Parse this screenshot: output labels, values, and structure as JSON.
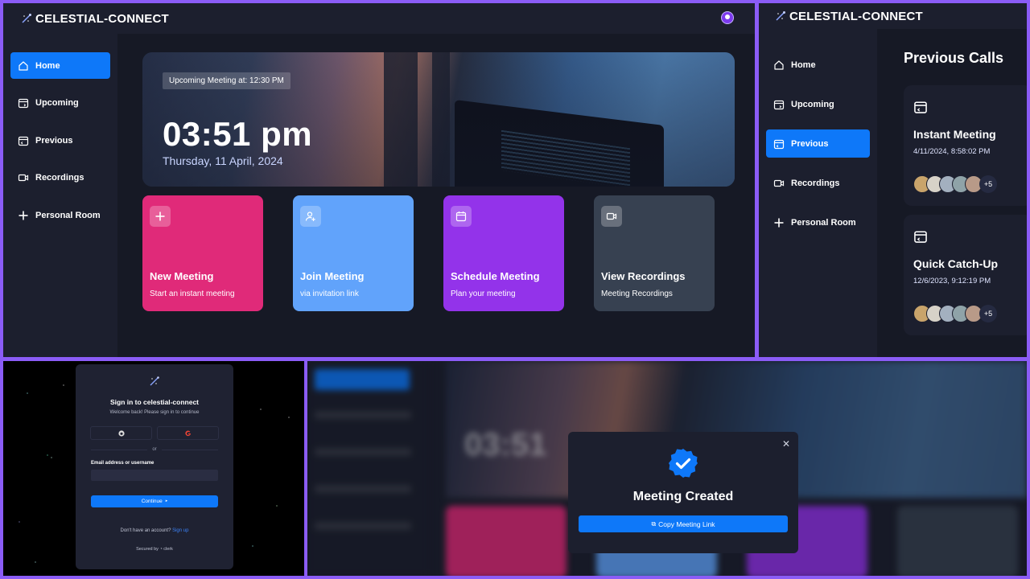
{
  "brand": "CELESTIAL-CONNECT",
  "colors": {
    "accent": "#0e78f9",
    "frame": "#8b5cf6",
    "bg_dark": "#1c1f2e",
    "bg_main": "#161925"
  },
  "sidebar": {
    "items": [
      {
        "label": "Home",
        "icon": "home-icon"
      },
      {
        "label": "Upcoming",
        "icon": "calendar-upcoming-icon"
      },
      {
        "label": "Previous",
        "icon": "calendar-previous-icon"
      },
      {
        "label": "Recordings",
        "icon": "video-icon"
      },
      {
        "label": "Personal Room",
        "icon": "plus-icon"
      }
    ]
  },
  "home": {
    "upcoming_pill": "Upcoming Meeting at: 12:30 PM",
    "time": "03:51 pm",
    "date": "Thursday, 11 April, 2024",
    "cards": [
      {
        "title": "New Meeting",
        "subtitle": "Start an instant meeting",
        "color": "#e02a79",
        "icon": "plus-icon"
      },
      {
        "title": "Join Meeting",
        "subtitle": "via invitation link",
        "color": "#61a3fb",
        "icon": "user-plus-icon"
      },
      {
        "title": "Schedule Meeting",
        "subtitle": "Plan your meeting",
        "color": "#9333ea",
        "icon": "calendar-icon"
      },
      {
        "title": "View Recordings",
        "subtitle": "Meeting Recordings",
        "color": "#374151",
        "icon": "video-icon"
      }
    ]
  },
  "previous": {
    "title": "Previous Calls",
    "calls": [
      {
        "title": "Instant Meeting",
        "datetime": "4/11/2024, 8:58:02 PM",
        "extra": "+5"
      },
      {
        "title": "Quick Catch-Up",
        "datetime": "12/6/2023, 9:12:19 PM",
        "extra": "+5"
      }
    ]
  },
  "signin": {
    "title": "Sign in to celestial-connect",
    "subtitle": "Welcome back! Please sign in to continue",
    "or": "or",
    "email_label": "Email address or username",
    "email_value": "",
    "continue": "Continue",
    "no_account": "Don't have an account?",
    "sign_up": "Sign up",
    "secured_by": "Secured by",
    "provider": "clerk"
  },
  "modal": {
    "title": "Meeting Created",
    "button": "Copy Meeting Link",
    "blur_time": "03:51"
  }
}
